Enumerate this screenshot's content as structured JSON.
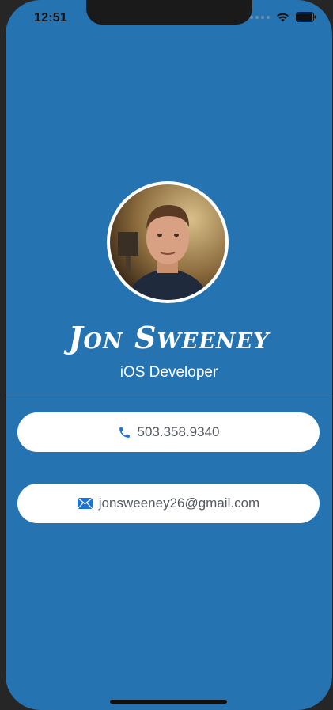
{
  "status_bar": {
    "time": "12:51"
  },
  "profile": {
    "name": "Jon Sweeney",
    "role": "iOS Developer"
  },
  "contacts": {
    "phone": "503.358.9340",
    "email": "jonsweeney26@gmail.com"
  },
  "icons": {
    "phone": "phone-icon",
    "email": "envelope-icon",
    "wifi": "wifi-icon",
    "battery": "battery-icon",
    "signal": "signal-dots-icon"
  },
  "colors": {
    "background": "#2573b0",
    "pill": "#ffffff",
    "icon_accent": "#1a73d9",
    "text_on_pill": "#555a60"
  }
}
